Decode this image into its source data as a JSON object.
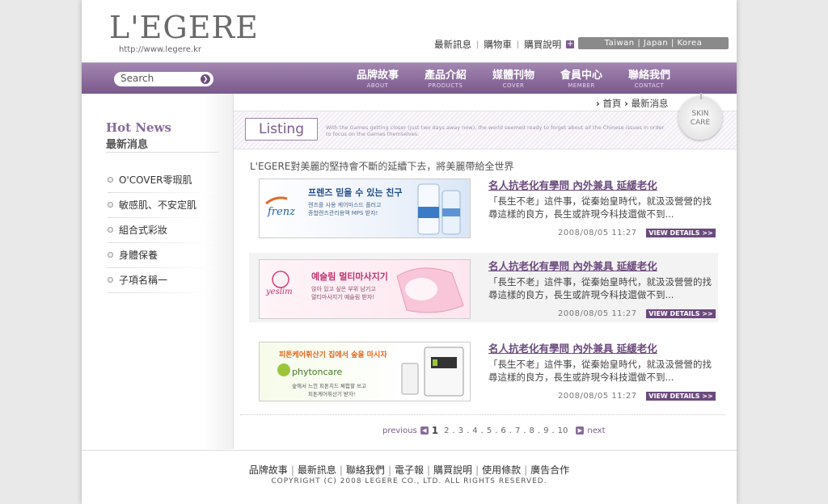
{
  "header": {
    "logo": "L'EGERE",
    "url": "http://www.legere.kr",
    "links": [
      "最新訊息",
      "購物車",
      "購買說明"
    ],
    "region": "Taiwan | Japan | Korea"
  },
  "nav": {
    "search_placeholder": "Search",
    "items": [
      {
        "zh": "品牌故事",
        "en": "ABOUT"
      },
      {
        "zh": "產品介紹",
        "en": "PRODUCTS"
      },
      {
        "zh": "媒體刊物",
        "en": "COVER"
      },
      {
        "zh": "會員中心",
        "en": "MEMBER"
      },
      {
        "zh": "聯絡我們",
        "en": "CONTACT"
      }
    ]
  },
  "sidebar": {
    "title_en": "Hot News",
    "title_zh": "最新消息",
    "items": [
      "O'COVER零瑕肌",
      "敏感肌、不安定肌",
      "組合式彩妝",
      "身體保養",
      "子項名稱一"
    ]
  },
  "breadcrumb": {
    "home": "首頁",
    "current": "最新消息"
  },
  "listing": {
    "title": "Listing",
    "desc": "With the Games getting closer (just two days away now), the world seemed ready to forget about all the Chinese issues in order to focus on the Games themselves.",
    "badge_line1": "SKIN",
    "badge_line2": "CARE"
  },
  "slogan": "L'EGERE對美麗的堅持會不斷的延續下去，將美麗帶給全世界",
  "news": [
    {
      "title": "名人抗老化有學問 內外兼具 延緩老化",
      "body": "「長生不老」這件事，從秦始皇時代，就汲汲營營的找尋這樣的良方，長生或許現今科技還做不到...",
      "date": "2008/08/05 11:27",
      "button": "VIEW DETAILS >>",
      "banner": {
        "brand": "frenz",
        "headline": "프렌즈 믿을 수 있는 친구",
        "sub1": "렌즈를 사용 케어마스드 플러고",
        "sub2": "종합렌즈관리용액 MPS 받자!"
      }
    },
    {
      "title": "名人抗老化有學問 內外兼具 延緩老化",
      "body": "「長生不老」這件事，從秦始皇時代，就汲汲營營的找尋這樣的良方，長生或許現今科技還做不到...",
      "date": "2008/08/05 11:27",
      "button": "VIEW DETAILS >>",
      "banner": {
        "brand": "yeslim",
        "headline": "예슬림 멀티마사지기",
        "sub1": "앉아 있고 싶은 부위 남기고",
        "sub2": "멀티마사지기 예슬림 받자!"
      }
    },
    {
      "title": "名人抗老化有學問 內外兼具 延緩老化",
      "body": "「長生不老」這件事，從秦始皇時代，就汲汲營營的找尋這樣的良方，長生或許現今科技還做不到...",
      "date": "2008/08/05 11:27",
      "button": "VIEW DETAILS >>",
      "banner": {
        "brand": "phytoncare",
        "headline": "피톤케어휘산기 집에서 숲을 마시자",
        "sub1": "숲에서 느낀 피톤치드 체험할 쓰고",
        "sub2": "피톤케어휘산기 받자!"
      }
    }
  ],
  "pager": {
    "previous": "previous",
    "next": "next",
    "current": "1",
    "pages": [
      "2",
      "3",
      "4",
      "5",
      "6",
      "7",
      "8",
      "9",
      "10"
    ]
  },
  "footer": {
    "links": [
      "品牌故事",
      "最新訊息",
      "聯絡我們",
      "電子報",
      "購買說明",
      "使用條款",
      "廣告合作"
    ],
    "copyright": "COPYRIGHT (C) 2008 LEGERE CO., LTD. ALL RIGHTS RESERVED."
  },
  "colors": {
    "accent": "#8a6a9b",
    "link": "#6b4a7d"
  }
}
